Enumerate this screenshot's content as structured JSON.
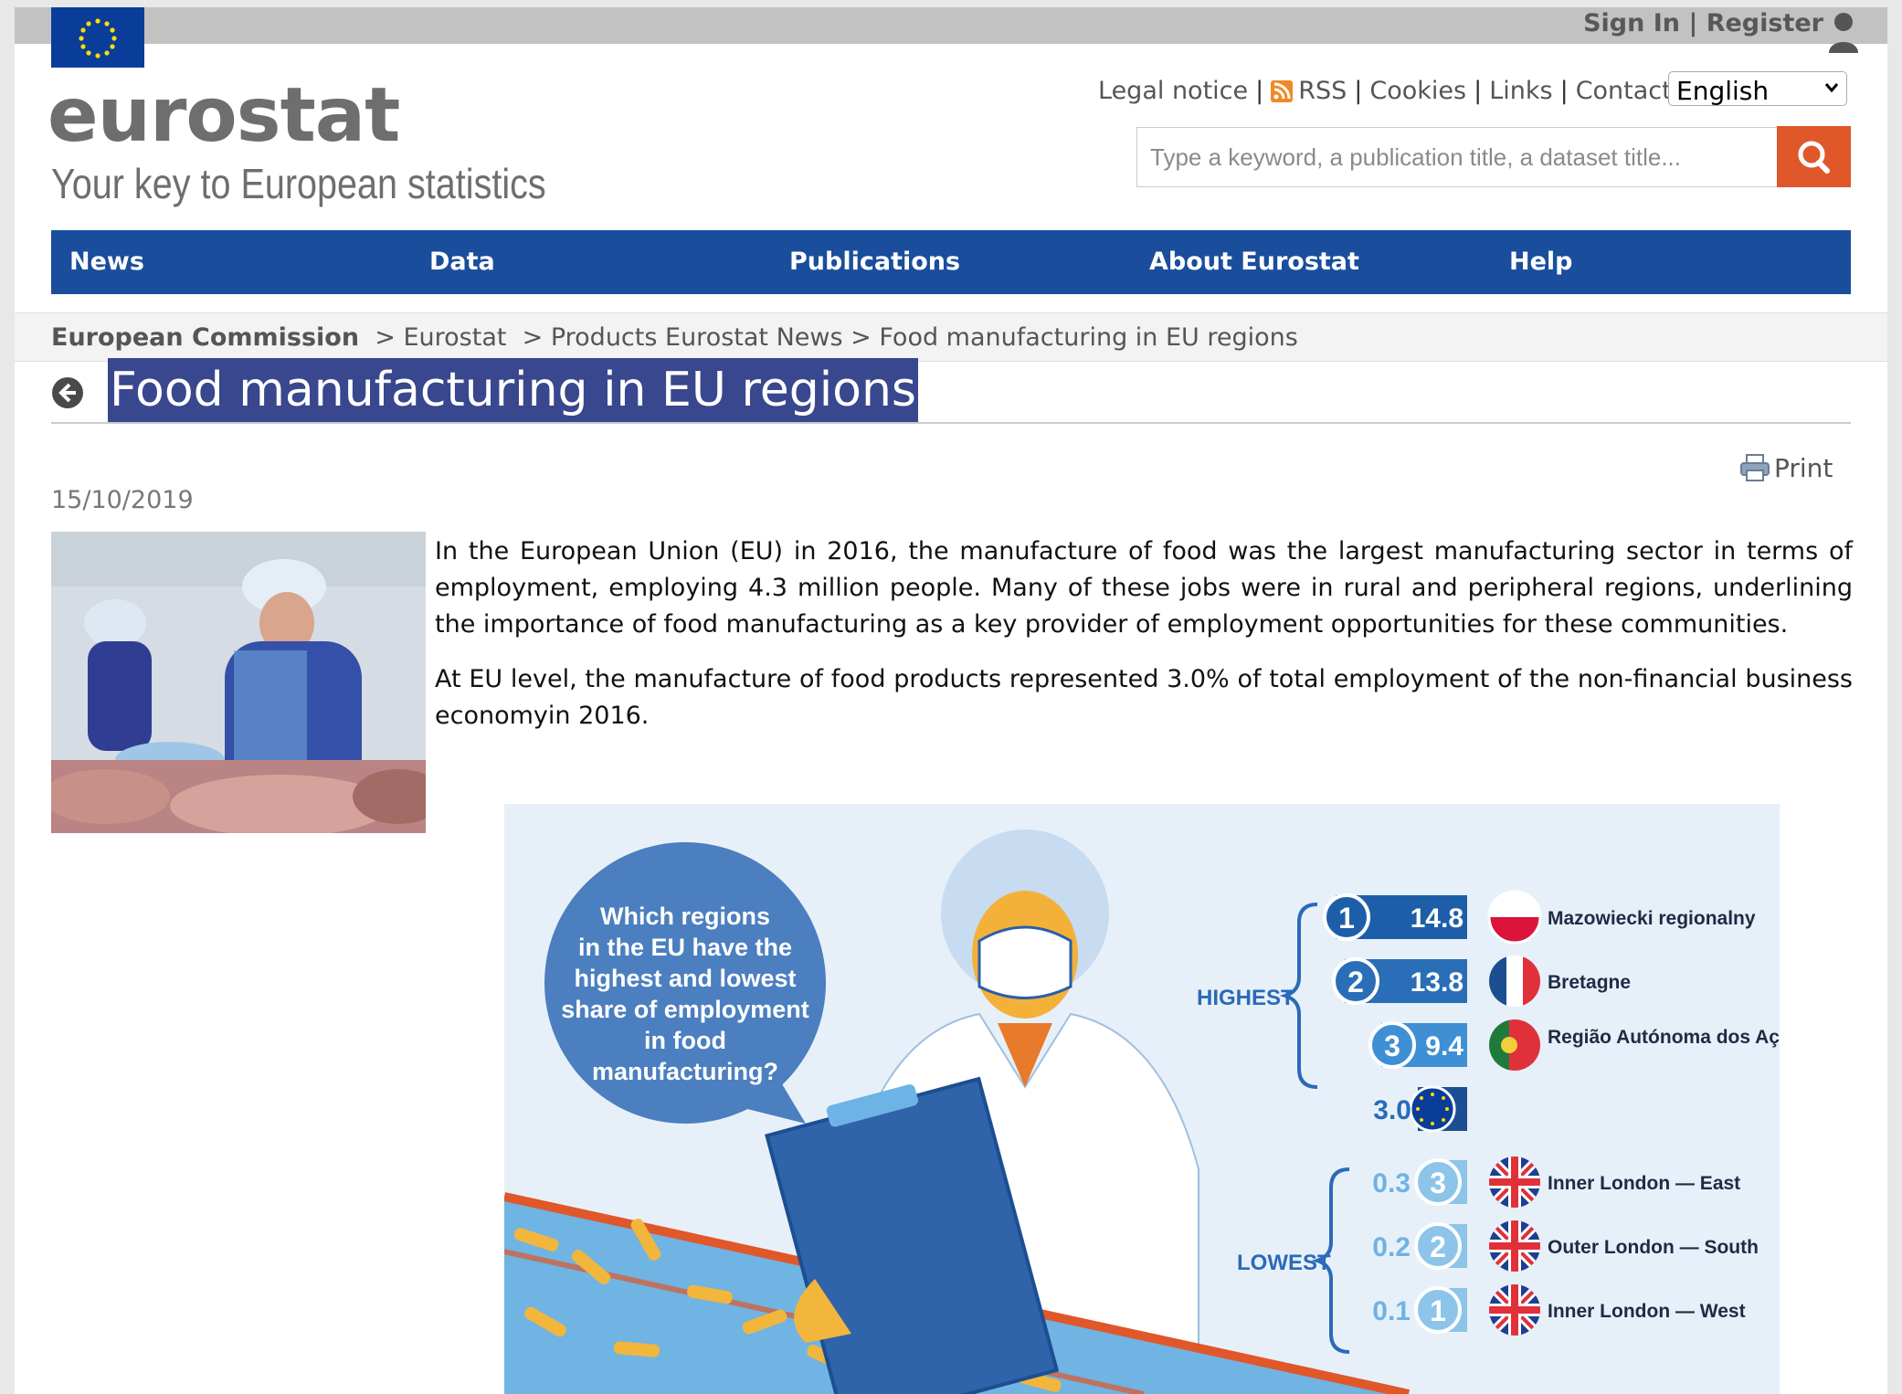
{
  "header": {
    "sign_in": "Sign In",
    "register": "Register",
    "logo": "eurostat",
    "tagline": "Your key to European statistics"
  },
  "toplinks": {
    "legal": "Legal notice",
    "rss": "RSS",
    "cookies": "Cookies",
    "links": "Links",
    "contact": "Contact"
  },
  "language": {
    "selected": "English"
  },
  "search": {
    "placeholder": "Type a keyword, a publication title, a dataset title..."
  },
  "nav": [
    "News",
    "Data",
    "Publications",
    "About Eurostat",
    "Help"
  ],
  "breadcrumb": {
    "items": [
      "European Commission",
      "Eurostat",
      "Products Eurostat News",
      "Food manufacturing in EU regions"
    ]
  },
  "article": {
    "title": "Food manufacturing in EU regions",
    "print": "Print",
    "date": "15/10/2019",
    "para1": "In the European Union (EU) in 2016, the manufacture of food was the largest manufacturing sector in terms of employment, employing 4.3 million people. Many of these jobs were in rural and peripheral regions, underlining the importance of food manufacturing as a key provider of employment opportunities for these communities.",
    "para2": "At EU level, the manufacture of food products represented 3.0% of total employment of the non-financial business economyin 2016."
  },
  "infographic": {
    "question_lines": [
      "Which regions",
      "in the EU have the",
      "highest and lowest",
      "share of employment",
      "in food",
      "manufacturing?"
    ],
    "highest_label": "HIGHEST",
    "lowest_label": "LOWEST",
    "eu_value": "3.0",
    "highest": [
      {
        "rank": "1",
        "value": "14.8",
        "region": "Mazowiecki regionalny",
        "flag": "poland"
      },
      {
        "rank": "2",
        "value": "13.8",
        "region": "Bretagne",
        "flag": "france"
      },
      {
        "rank": "3",
        "value": "9.4",
        "region": "Região Autónoma dos Açores",
        "flag": "portugal"
      }
    ],
    "lowest": [
      {
        "rank": "3",
        "value": "0.3",
        "region": "Inner London — East",
        "flag": "uk"
      },
      {
        "rank": "2",
        "value": "0.2",
        "region": "Outer London — South",
        "flag": "uk"
      },
      {
        "rank": "1",
        "value": "0.1",
        "region": "Inner London — West",
        "flag": "uk"
      }
    ],
    "colors": {
      "dark_blue": "#1c5fa8",
      "mid_blue": "#3f8fd4",
      "light_blue": "#6db3e6",
      "orange": "#e0572a",
      "yellow": "#f2b63c"
    }
  }
}
